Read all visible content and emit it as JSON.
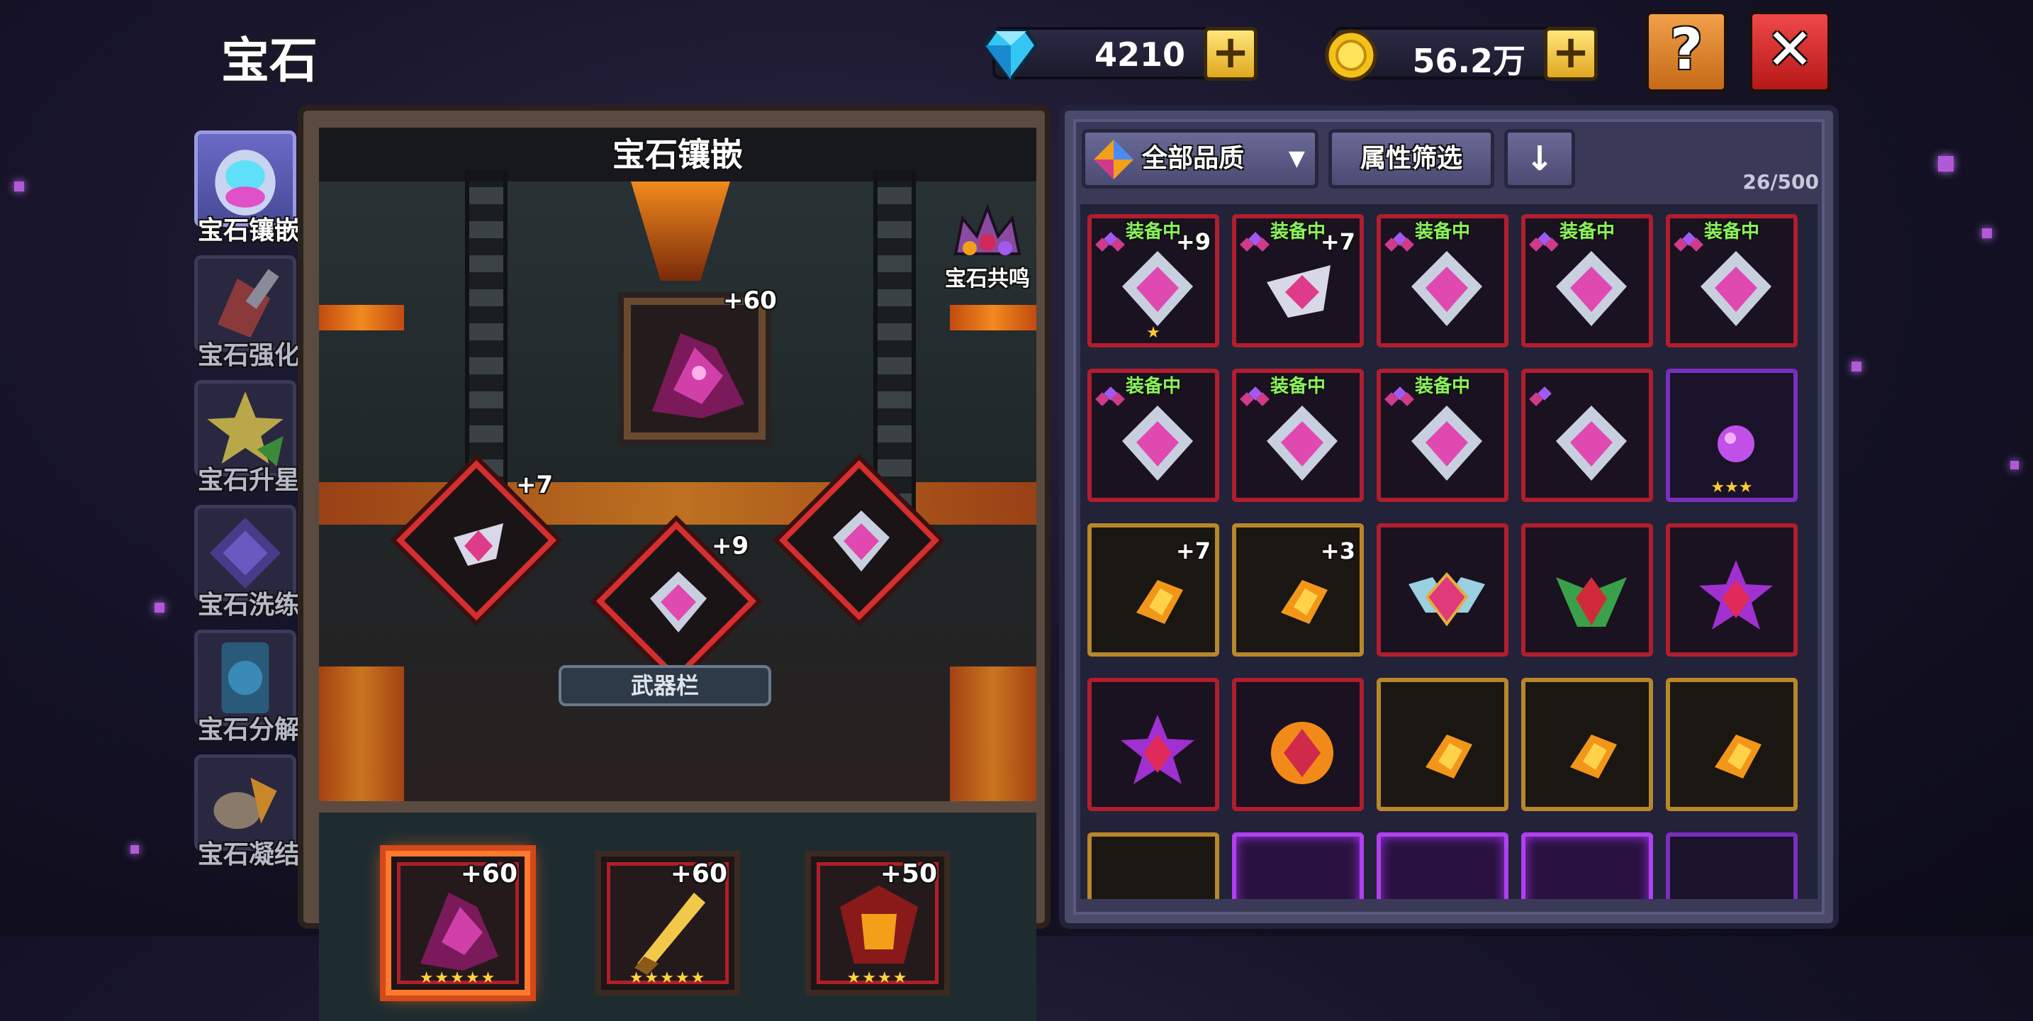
{
  "page_title": "宝石",
  "currency": {
    "diamonds": "4210",
    "gold": "56.2万"
  },
  "top_buttons": {
    "help": "?",
    "close": "✕",
    "add": "+"
  },
  "tabs": [
    {
      "label": "宝石镶嵌",
      "active": true
    },
    {
      "label": "宝石强化",
      "active": false
    },
    {
      "label": "宝石升星",
      "active": false
    },
    {
      "label": "宝石洗练",
      "active": false
    },
    {
      "label": "宝石分解",
      "active": false
    },
    {
      "label": "宝石凝结",
      "active": false
    }
  ],
  "socket": {
    "title": "宝石镶嵌",
    "resonance_label": "宝石共鸣",
    "main_level": "+60",
    "left_level": "+7",
    "center_level": "+9",
    "weapon_bar_label": "武器栏"
  },
  "weapons": [
    {
      "level": "+60",
      "stars": "★★★★★",
      "selected": true
    },
    {
      "level": "+60",
      "stars": "★★★★★",
      "selected": false
    },
    {
      "level": "+50",
      "stars": "★★★★",
      "selected": false
    }
  ],
  "inventory": {
    "quality_filter": "全部品质",
    "attribute_filter": "属性筛选",
    "sort_icon": "↓",
    "count": "26/500",
    "equipped_label": "装备中",
    "items": [
      {
        "equipped": true,
        "level": "+9",
        "stars": "★"
      },
      {
        "equipped": true,
        "level": "+7",
        "stars": ""
      },
      {
        "equipped": true,
        "level": "",
        "stars": ""
      },
      {
        "equipped": true,
        "level": "",
        "stars": ""
      },
      {
        "equipped": true,
        "level": "",
        "stars": ""
      },
      {
        "equipped": true,
        "level": "",
        "stars": ""
      },
      {
        "equipped": true,
        "level": "",
        "stars": ""
      },
      {
        "equipped": true,
        "level": "",
        "stars": ""
      },
      {
        "equipped": false,
        "level": "",
        "stars": ""
      },
      {
        "equipped": false,
        "level": "",
        "stars": "★★★"
      },
      {
        "equipped": false,
        "level": "+7",
        "stars": ""
      },
      {
        "equipped": false,
        "level": "+3",
        "stars": ""
      },
      {
        "equipped": false,
        "level": "",
        "stars": ""
      },
      {
        "equipped": false,
        "level": "",
        "stars": ""
      },
      {
        "equipped": false,
        "level": "",
        "stars": ""
      },
      {
        "equipped": false,
        "level": "",
        "stars": ""
      },
      {
        "equipped": false,
        "level": "",
        "stars": ""
      },
      {
        "equipped": false,
        "level": "",
        "stars": ""
      },
      {
        "equipped": false,
        "level": "",
        "stars": ""
      },
      {
        "equipped": false,
        "level": "",
        "stars": ""
      }
    ]
  },
  "colors": {
    "equipped_green": "#8af25a",
    "rarity_red": "#b01e2e",
    "rarity_gold": "#b8872a",
    "rarity_purple": "#7a2ec0",
    "selected_orange": "#ff7a2e"
  }
}
